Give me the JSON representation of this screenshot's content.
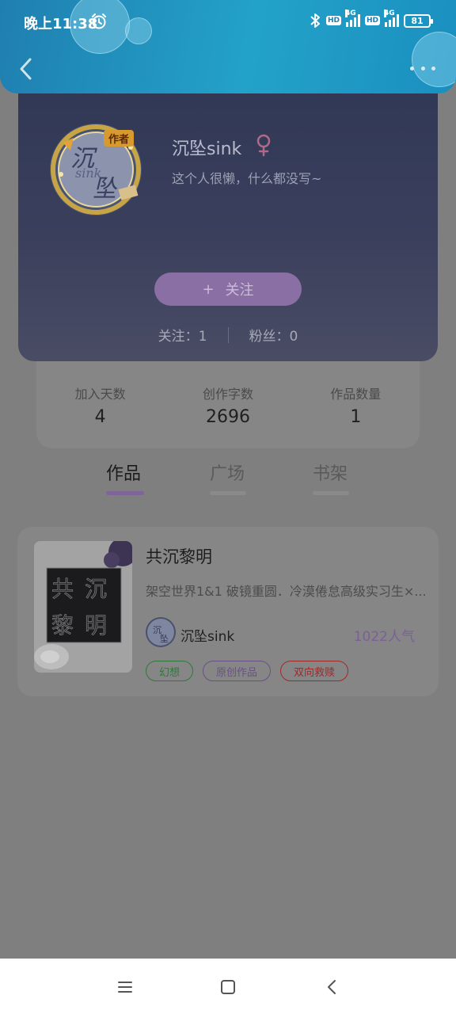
{
  "status_bar": {
    "time": "晚上11:38",
    "network_1": "4G",
    "network_2": "4G",
    "hd_1": "HD",
    "hd_2": "HD",
    "battery": "81"
  },
  "profile": {
    "username": "沉坠sink",
    "bio": "这个人很懒，什么都没写~",
    "avatar_badge": "作者",
    "follow_button": "关注",
    "follow_plus": "+",
    "following_label": "关注",
    "following_count": "1",
    "followers_label": "粉丝",
    "followers_count": "0"
  },
  "stats": [
    {
      "label": "加入天数",
      "value": "4"
    },
    {
      "label": "创作字数",
      "value": "2696"
    },
    {
      "label": "作品数量",
      "value": "1"
    }
  ],
  "tabs": [
    {
      "label": "作品",
      "active": true
    },
    {
      "label": "广场",
      "active": false
    },
    {
      "label": "书架",
      "active": false
    }
  ],
  "work": {
    "title": "共沉黎明",
    "description": "架空世界1&1 破镜重圆．冷漠倦怠高级实习生×...",
    "author": "沉坠sink",
    "popularity": "1022人气",
    "tags": [
      {
        "label": "幻想",
        "color": "#2f7a3a"
      },
      {
        "label": "原创作品",
        "color": "#6a4f86"
      },
      {
        "label": "双向救赎",
        "color": "#a02a2a"
      }
    ]
  },
  "colors": {
    "header": "#23a2c8",
    "accent_purple": "#8a6fa4",
    "overlay": "#7f7f7f"
  },
  "icons": {
    "back": "chevron-left-icon",
    "more": "more-dots-icon",
    "gender": "female-icon",
    "alarm": "alarm-icon",
    "bluetooth": "bluetooth-icon"
  }
}
